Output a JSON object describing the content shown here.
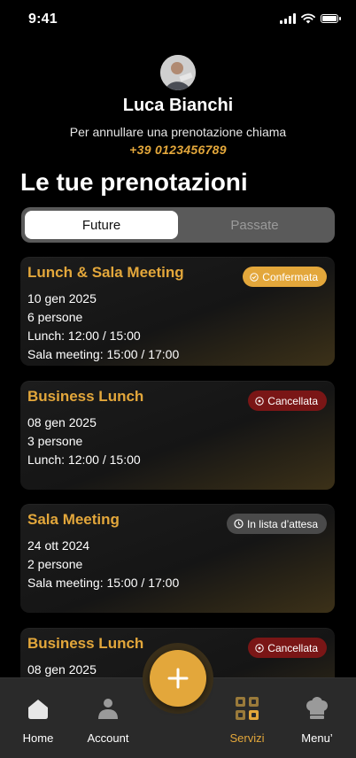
{
  "status": {
    "time": "9:41"
  },
  "profile": {
    "name": "Luca Bianchi",
    "subtitle": "Per annullare una prenotazione chiama",
    "phone": "+39 0123456789"
  },
  "page_title": "Le tue prenotazioni",
  "segments": {
    "future": "Future",
    "past": "Passate",
    "selected": "Future"
  },
  "bookings": [
    {
      "title": "Lunch & Sala Meeting",
      "status": "Confermata",
      "status_kind": "confirmed",
      "date": "10 gen 2025",
      "people": "6 persone",
      "lines": [
        "Lunch: 12:00 / 15:00",
        "Sala meeting: 15:00 / 17:00"
      ]
    },
    {
      "title": "Business Lunch",
      "status": "Cancellata",
      "status_kind": "cancelled",
      "date": "08 gen 2025",
      "people": "3 persone",
      "lines": [
        "Lunch: 12:00 / 15:00"
      ]
    },
    {
      "title": "Sala Meeting",
      "status": "In lista d’attesa",
      "status_kind": "waitlist",
      "date": "24 ott 2024",
      "people": "2 persone",
      "lines": [
        "Sala meeting: 15:00 / 17:00"
      ]
    },
    {
      "title": "Business Lunch",
      "status": "Cancellata",
      "status_kind": "cancelled",
      "date": "08 gen 2025"
    }
  ],
  "tabbar": {
    "home": "Home",
    "account": "Account",
    "services": "Servizi",
    "menu": "Menu’",
    "active": "Servizi"
  },
  "colors": {
    "accent": "#e3a73b",
    "cancelled": "#7a1616",
    "waitlist": "#4a4a4a"
  },
  "icons": {
    "fab": "plus-icon",
    "home": "home-icon",
    "account": "person-icon",
    "services": "qr-grid-icon",
    "menu": "chef-hat-icon"
  }
}
